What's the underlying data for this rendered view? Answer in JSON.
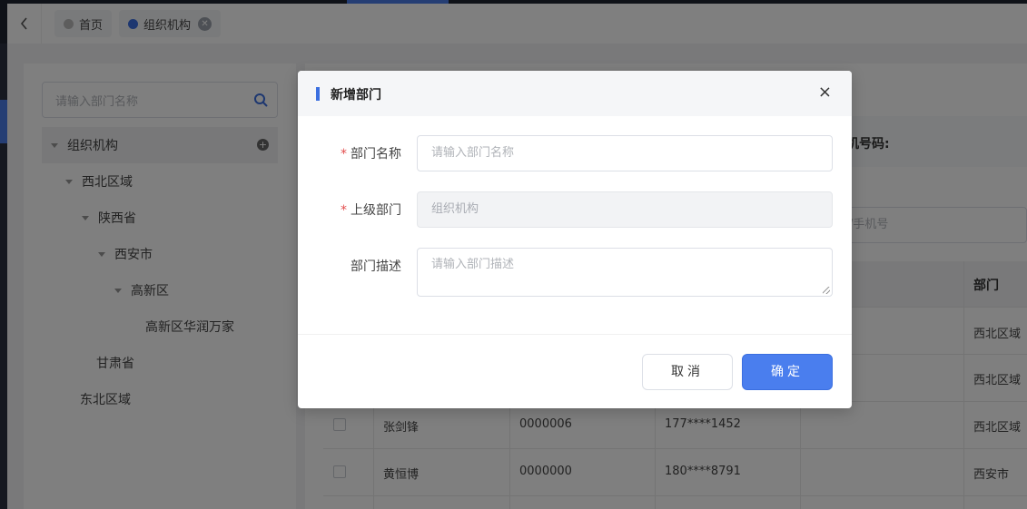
{
  "tabs": [
    {
      "label": "首页",
      "active": false
    },
    {
      "label": "组织机构",
      "active": true
    }
  ],
  "tree": {
    "search_placeholder": "请输入部门名称",
    "nodes": [
      {
        "label": "组织机构",
        "level": 0
      },
      {
        "label": "西北区域",
        "level": 1
      },
      {
        "label": "陕西省",
        "level": 2
      },
      {
        "label": "西安市",
        "level": 3
      },
      {
        "label": "高新区",
        "level": 4
      },
      {
        "label": "高新区华润万家",
        "level": 5
      },
      {
        "label": "甘肃省",
        "level": 2
      },
      {
        "label": "东北区域",
        "level": 1
      }
    ]
  },
  "filter": {
    "label": "机号码:",
    "placeholder": "/手机号"
  },
  "table": {
    "dept_header": "部门",
    "rows": [
      {
        "name": "",
        "code": "",
        "phone": "",
        "dept": "西北区域"
      },
      {
        "name": "",
        "code": "",
        "phone": "",
        "dept": "西北区域"
      },
      {
        "name": "张剑锋",
        "code": "0000006",
        "phone": "177****1452",
        "dept": "西北区域"
      },
      {
        "name": "黄恒博",
        "code": "0000000",
        "phone": "180****8791",
        "dept": "西安市"
      }
    ]
  },
  "dialog": {
    "title": "新增部门",
    "close": "×",
    "fields": {
      "name_label": "部门名称",
      "name_placeholder": "请输入部门名称",
      "parent_label": "上级部门",
      "parent_value": "组织机构",
      "desc_label": "部门描述",
      "desc_placeholder": "请输入部门描述"
    },
    "required_mark": "*",
    "cancel_label": "取消",
    "ok_label": "确定"
  },
  "colors": {
    "accent": "#3b6fe0",
    "required": "#e34d4d"
  }
}
